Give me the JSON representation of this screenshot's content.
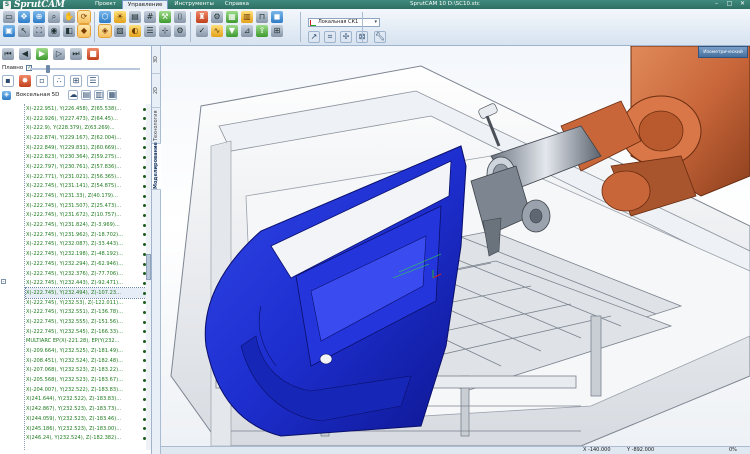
{
  "app": {
    "logo": "SprutCAM",
    "title": "SprutCAM 10   D:\\SC10.stc",
    "menu": [
      "Проект",
      "Управление",
      "Инструменты",
      "Справка"
    ],
    "active_menu": "Управление",
    "window_buttons": [
      "–",
      "□",
      "✕"
    ]
  },
  "ribbon": {
    "coordinate_system": "Локальная СК1"
  },
  "left_panel": {
    "smooth_label": "Плавно",
    "smooth_checked": "✓",
    "slider_value": 0.15,
    "axis_label": "Воксельная 5D",
    "tree_toggle": "–",
    "rows": [
      "X(-222.951), Y(226.458), Z(65.538)...",
      "X(-222.926), Y(227.473), Z(64.45)...",
      "X(-222.9), Y(228.379), Z(63.269)...",
      "X(-222.874), Y(229.167), Z(62.004)...",
      "X(-222.849), Y(229.831), Z(60.669)...",
      "X(-222.823), Y(230.364), Z(59.275)...",
      "X(-222.797), Y(230.761), Z(57.836)...",
      "X(-222.771), Y(231.021), Z(56.365)...",
      "X(-222.745), Y(231.141), Z(54.875)...",
      "X(-222.745), Y(231.33), Z(40.179)...",
      "X(-222.745), Y(231.507), Z(25.473)...",
      "X(-222.745), Y(231.672), Z(10.757)...",
      "X(-222.745), Y(231.824), Z(-3.969)...",
      "X(-222.745), Y(231.962), Z(-18.702)...",
      "X(-222.745), Y(232.087), Z(-33.443)...",
      "X(-222.745), Y(232.198), Z(-48.192)...",
      "X(-222.745), Y(232.294), Z(-62.946)...",
      "X(-222.745), Y(232.376), Z(-77.706)...",
      "X(-222.745), Y(232.443), Z(-92.471)...",
      "X(-222.745), Y(232.494), Z(-107.23...",
      "X(-222.745), Y(232.53), Z(-122.011)...",
      "X(-222.745), Y(232.551), Z(-136.78)...",
      "X(-222.745), Y(232.555), Z(-151.56)...",
      "X(-222.745), Y(232.545), Z(-166.33)...",
      "MULTIARC EP(X(-221.28), EP(Y(232...",
      "X(-209.664), Y(232.525), Z(-181.49)...",
      "X(-208.451), Y(232.524), Z(-182.48)...",
      "X(-207.068), Y(232.523), Z(-183.22)...",
      "X(-205.568), Y(232.523), Z(-183.67)...",
      "X(-204.007), Y(232.522), Z(-183.83)...",
      "X(241.644), Y(232.522), Z(-183.83)...",
      "X(242.867), Y(232.523), Z(-183.73)...",
      "X(244.059), Y(232.523), Z(-183.46)...",
      "X(245.186), Y(232.523), Z(-183.00)...",
      "X(246.24), Y(232.524), Z(-182.382)..."
    ],
    "selected_row": 19
  },
  "vertical_tabs": [
    "3D Модель",
    "2D Геометрия",
    "Технология",
    "Моделирование"
  ],
  "active_vertical_tab": "Моделирование",
  "viewport": {
    "viewcube_label": "Изометрический"
  },
  "statusbar": {
    "x": "X -140.000",
    "y": "Y -892.000",
    "zoom": "0%"
  },
  "colors": {
    "titlebar": "#2d6f63",
    "part": "#1e2fd0",
    "robot": "#c8663a",
    "toolpath": "#1e7a1e"
  }
}
